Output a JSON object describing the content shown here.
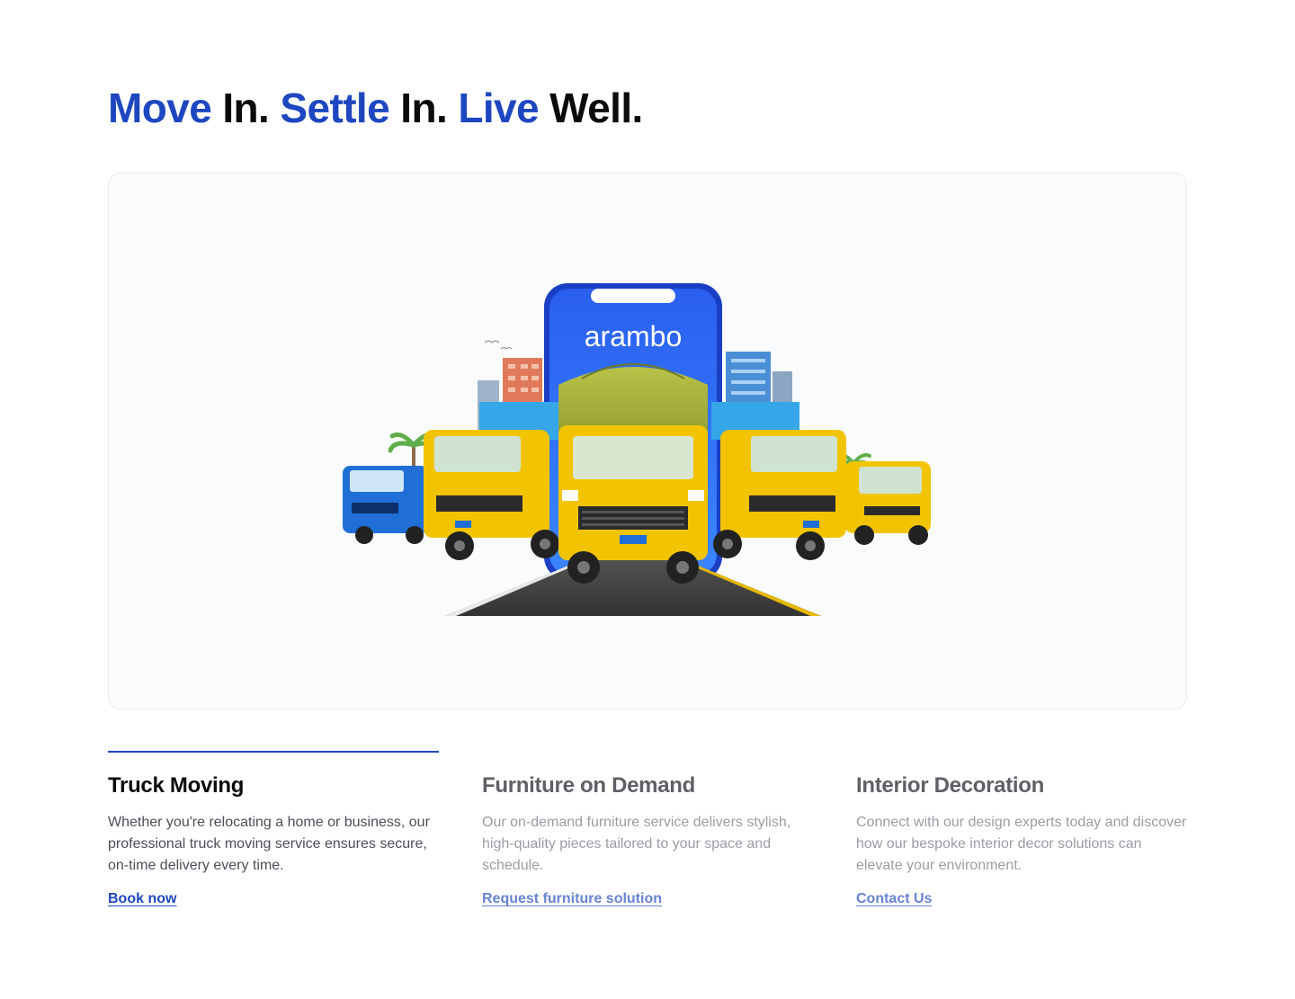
{
  "headline": {
    "word1": "Move",
    "word2": " In. ",
    "word3": "Settle",
    "word4": " In. ",
    "word5": "Live",
    "word6": " Well."
  },
  "hero": {
    "brand": "arambo"
  },
  "features": [
    {
      "title": "Truck Moving",
      "description": "Whether you're relocating a home or business, our professional truck moving service ensures secure, on-time delivery every time.",
      "link": "Book now",
      "active": true
    },
    {
      "title": "Furniture on Demand",
      "description": "Our on-demand furniture service delivers stylish, high-quality pieces tailored to your space and schedule.",
      "link": "Request furniture solution",
      "active": false
    },
    {
      "title": "Interior Decoration",
      "description": "Connect with our design experts today and discover how our bespoke interior decor solutions can elevate your environment.",
      "link": "Contact Us",
      "active": false
    }
  ],
  "colors": {
    "accent": "#1e46c0",
    "truck_yellow": "#f2c400",
    "truck_blue": "#1f6fd6"
  }
}
